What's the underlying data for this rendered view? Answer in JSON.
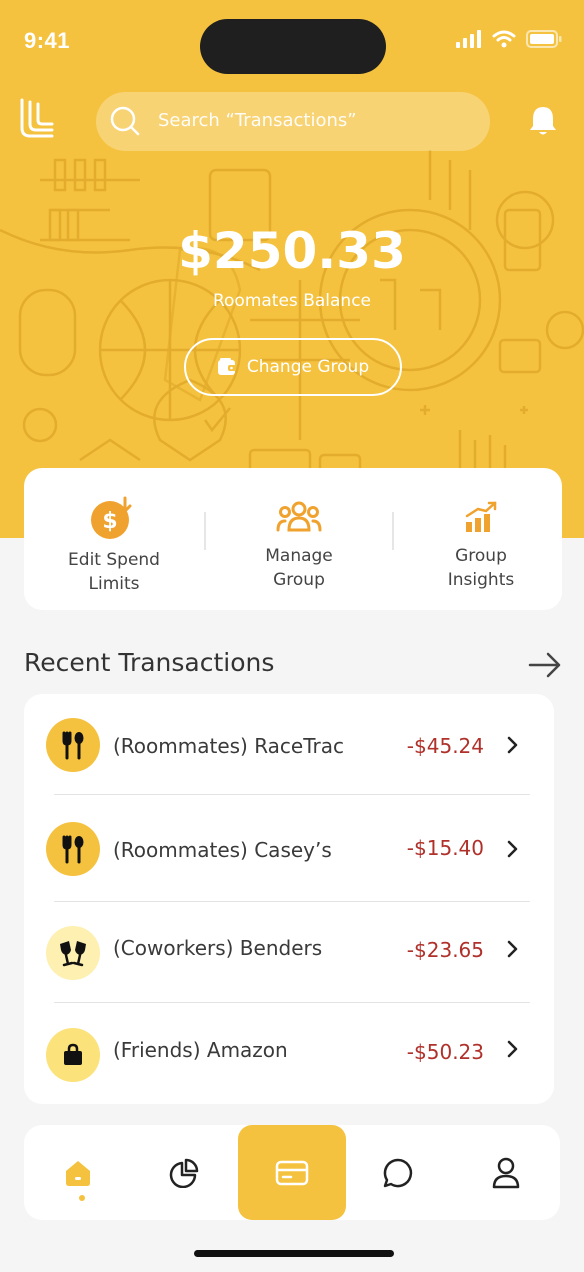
{
  "status_bar": {
    "time": "9:41"
  },
  "header": {
    "logo_icon": "logo-icon",
    "search": {
      "placeholder": "Search “Transactions”",
      "icon": "search-icon"
    },
    "notification_icon": "bell-icon"
  },
  "balance": {
    "amount": "$250.33",
    "label": "Roomates Balance",
    "change_group_label": "Change Group",
    "change_group_icon": "wallet-icon"
  },
  "quick_actions": [
    {
      "label_line1": "Edit Spend",
      "label_line2": "Limits",
      "icon": "dollar-coin-icon"
    },
    {
      "label_line1": "Manage",
      "label_line2": "Group",
      "icon": "group-icon"
    },
    {
      "label_line1": "Group",
      "label_line2": "Insights",
      "icon": "growth-chart-icon"
    }
  ],
  "recent_transactions": {
    "title": "Recent Transactions",
    "items": [
      {
        "name": "(Roommates) RaceTrac",
        "amount": "-$45.24",
        "icon": "fork-spoon-icon"
      },
      {
        "name": "(Roommates) Casey’s",
        "amount": "-$15.40",
        "icon": "fork-spoon-icon"
      },
      {
        "name": "(Coworkers) Benders",
        "amount": "-$23.65",
        "icon": "cheers-glasses-icon"
      },
      {
        "name": "(Friends) Amazon",
        "amount": "-$50.23",
        "icon": "shopping-bag-icon"
      }
    ]
  },
  "tab_bar": {
    "tabs": [
      {
        "name": "home",
        "icon": "home-icon",
        "active": true
      },
      {
        "name": "insights",
        "icon": "pie-chart-icon"
      },
      {
        "name": "card",
        "icon": "card-icon"
      },
      {
        "name": "messages",
        "icon": "chat-icon"
      },
      {
        "name": "profile",
        "icon": "user-icon"
      }
    ]
  },
  "colors": {
    "brand_yellow": "#f5c23f",
    "amount_red": "#b0302a",
    "icon_bg_yellow": "#f5c23f",
    "icon_bg_light": "#fdf0b0"
  }
}
